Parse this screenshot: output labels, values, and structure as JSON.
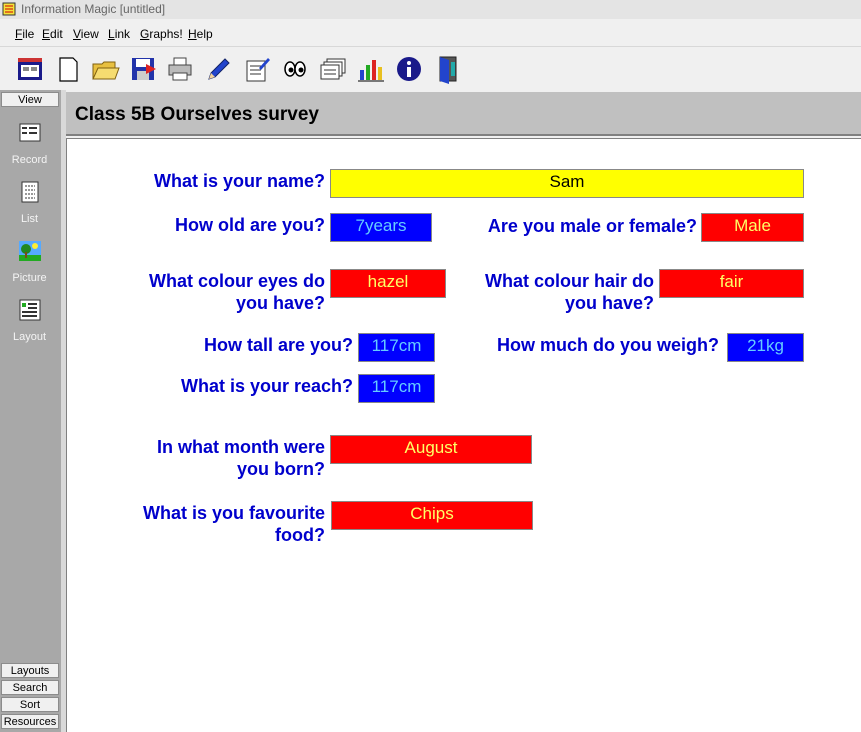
{
  "window": {
    "title": "Information Magic [untitled]"
  },
  "menu": [
    "File",
    "Edit",
    "View",
    "Link",
    "Graphs!",
    "Help"
  ],
  "toolbar": [
    "database-icon",
    "new-icon",
    "open-icon",
    "save-icon",
    "print-icon",
    "edit-pencil-icon",
    "record-icon",
    "view-eyes-icon",
    "cards-icon",
    "graph-icon",
    "info-icon",
    "exit-door-icon"
  ],
  "sidebar": {
    "view_label": "View",
    "tools": [
      {
        "label": "Record",
        "icon": "record-icon"
      },
      {
        "label": "List",
        "icon": "list-icon"
      },
      {
        "label": "Picture",
        "icon": "picture-icon"
      },
      {
        "label": "Layout",
        "icon": "layout-icon"
      }
    ],
    "bottom_buttons": [
      "Layouts",
      "Search",
      "Sort",
      "Resources"
    ]
  },
  "header": {
    "title": "Class 5B Ourselves survey"
  },
  "form": {
    "name_q": "What is your name?",
    "name_v": "Sam",
    "age_q": "How old are you?",
    "age_v": "7years",
    "sex_q": "Are you male or female?",
    "sex_v": "Male",
    "eyes_q1": "What colour eyes do",
    "eyes_q2": "you have?",
    "eyes_v": "hazel",
    "hair_q1": "What colour hair do",
    "hair_q2": "you have?",
    "hair_v": "fair",
    "tall_q": "How tall are you?",
    "tall_v": "117cm",
    "weigh_q": "How much do you weigh?",
    "weigh_v": "21kg",
    "reach_q": "What is your reach?",
    "reach_v": "117cm",
    "month_q1": "In what month were",
    "month_q2": "you born?",
    "month_v": "August",
    "food_q1": "What is you favourite",
    "food_q2": "food?",
    "food_v": "Chips"
  },
  "colors": {
    "question": "#0000cc",
    "yellow_field": "#ffff00",
    "blue_field": "#0000ff",
    "red_field": "#ff0000"
  }
}
